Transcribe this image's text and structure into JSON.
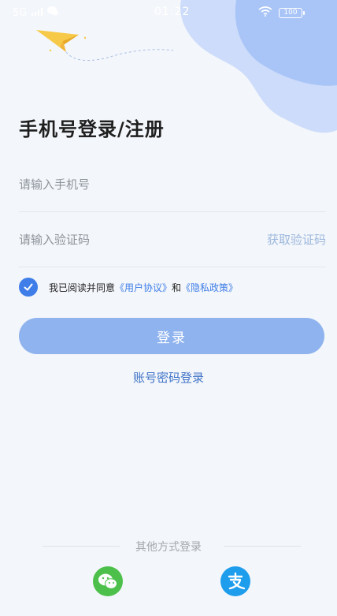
{
  "status_bar": {
    "carrier": "5G",
    "time": "01:22",
    "battery": "100"
  },
  "page": {
    "title": "手机号登录/注册"
  },
  "form": {
    "phone_placeholder": "请输入手机号",
    "code_placeholder": "请输入验证码",
    "get_code": "获取验证码"
  },
  "agreement": {
    "checked": true,
    "prefix": "我已阅读并同意",
    "user_agreement": "《用户协议》",
    "and": "和",
    "privacy_policy": "《隐私政策》"
  },
  "login_button": "登录",
  "password_login": "账号密码登录",
  "other_login": {
    "label": "其他方式登录",
    "methods": [
      "wechat-icon",
      "alipay-icon"
    ]
  },
  "colors": {
    "accent": "#3f7ee8",
    "button": "#8fb3ee",
    "blob": "#a9c5f7",
    "wechat": "#4cc04a",
    "alipay": "#1e9ded"
  }
}
